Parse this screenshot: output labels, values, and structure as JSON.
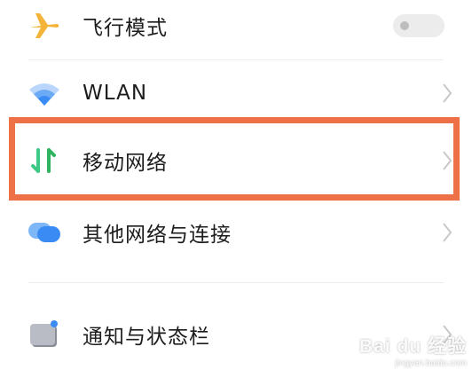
{
  "settings": {
    "items": [
      {
        "label": "飞行模式",
        "icon": "airplane-icon",
        "control": "toggle",
        "toggle_on": false
      },
      {
        "label": "WLAN",
        "icon": "wifi-icon",
        "control": "chevron"
      },
      {
        "label": "移动网络",
        "icon": "mobile-data-icon",
        "control": "chevron",
        "highlighted": true
      },
      {
        "label": "其他网络与连接",
        "icon": "other-connections-icon",
        "control": "chevron"
      },
      {
        "label": "通知与状态栏",
        "icon": "notification-icon",
        "control": "chevron"
      }
    ]
  },
  "colors": {
    "highlight": "#ee7047",
    "airplane": "#f4b43a",
    "wifi": "#3a8cf4",
    "mobile_data_up": "#3fc987",
    "mobile_data_down": "#2eb45e",
    "bubble_front": "#3a8cf4",
    "bubble_back": "#7db7f7"
  },
  "watermark": {
    "brand": "Bai du 经验",
    "url": "jingyan.baidu.com"
  }
}
